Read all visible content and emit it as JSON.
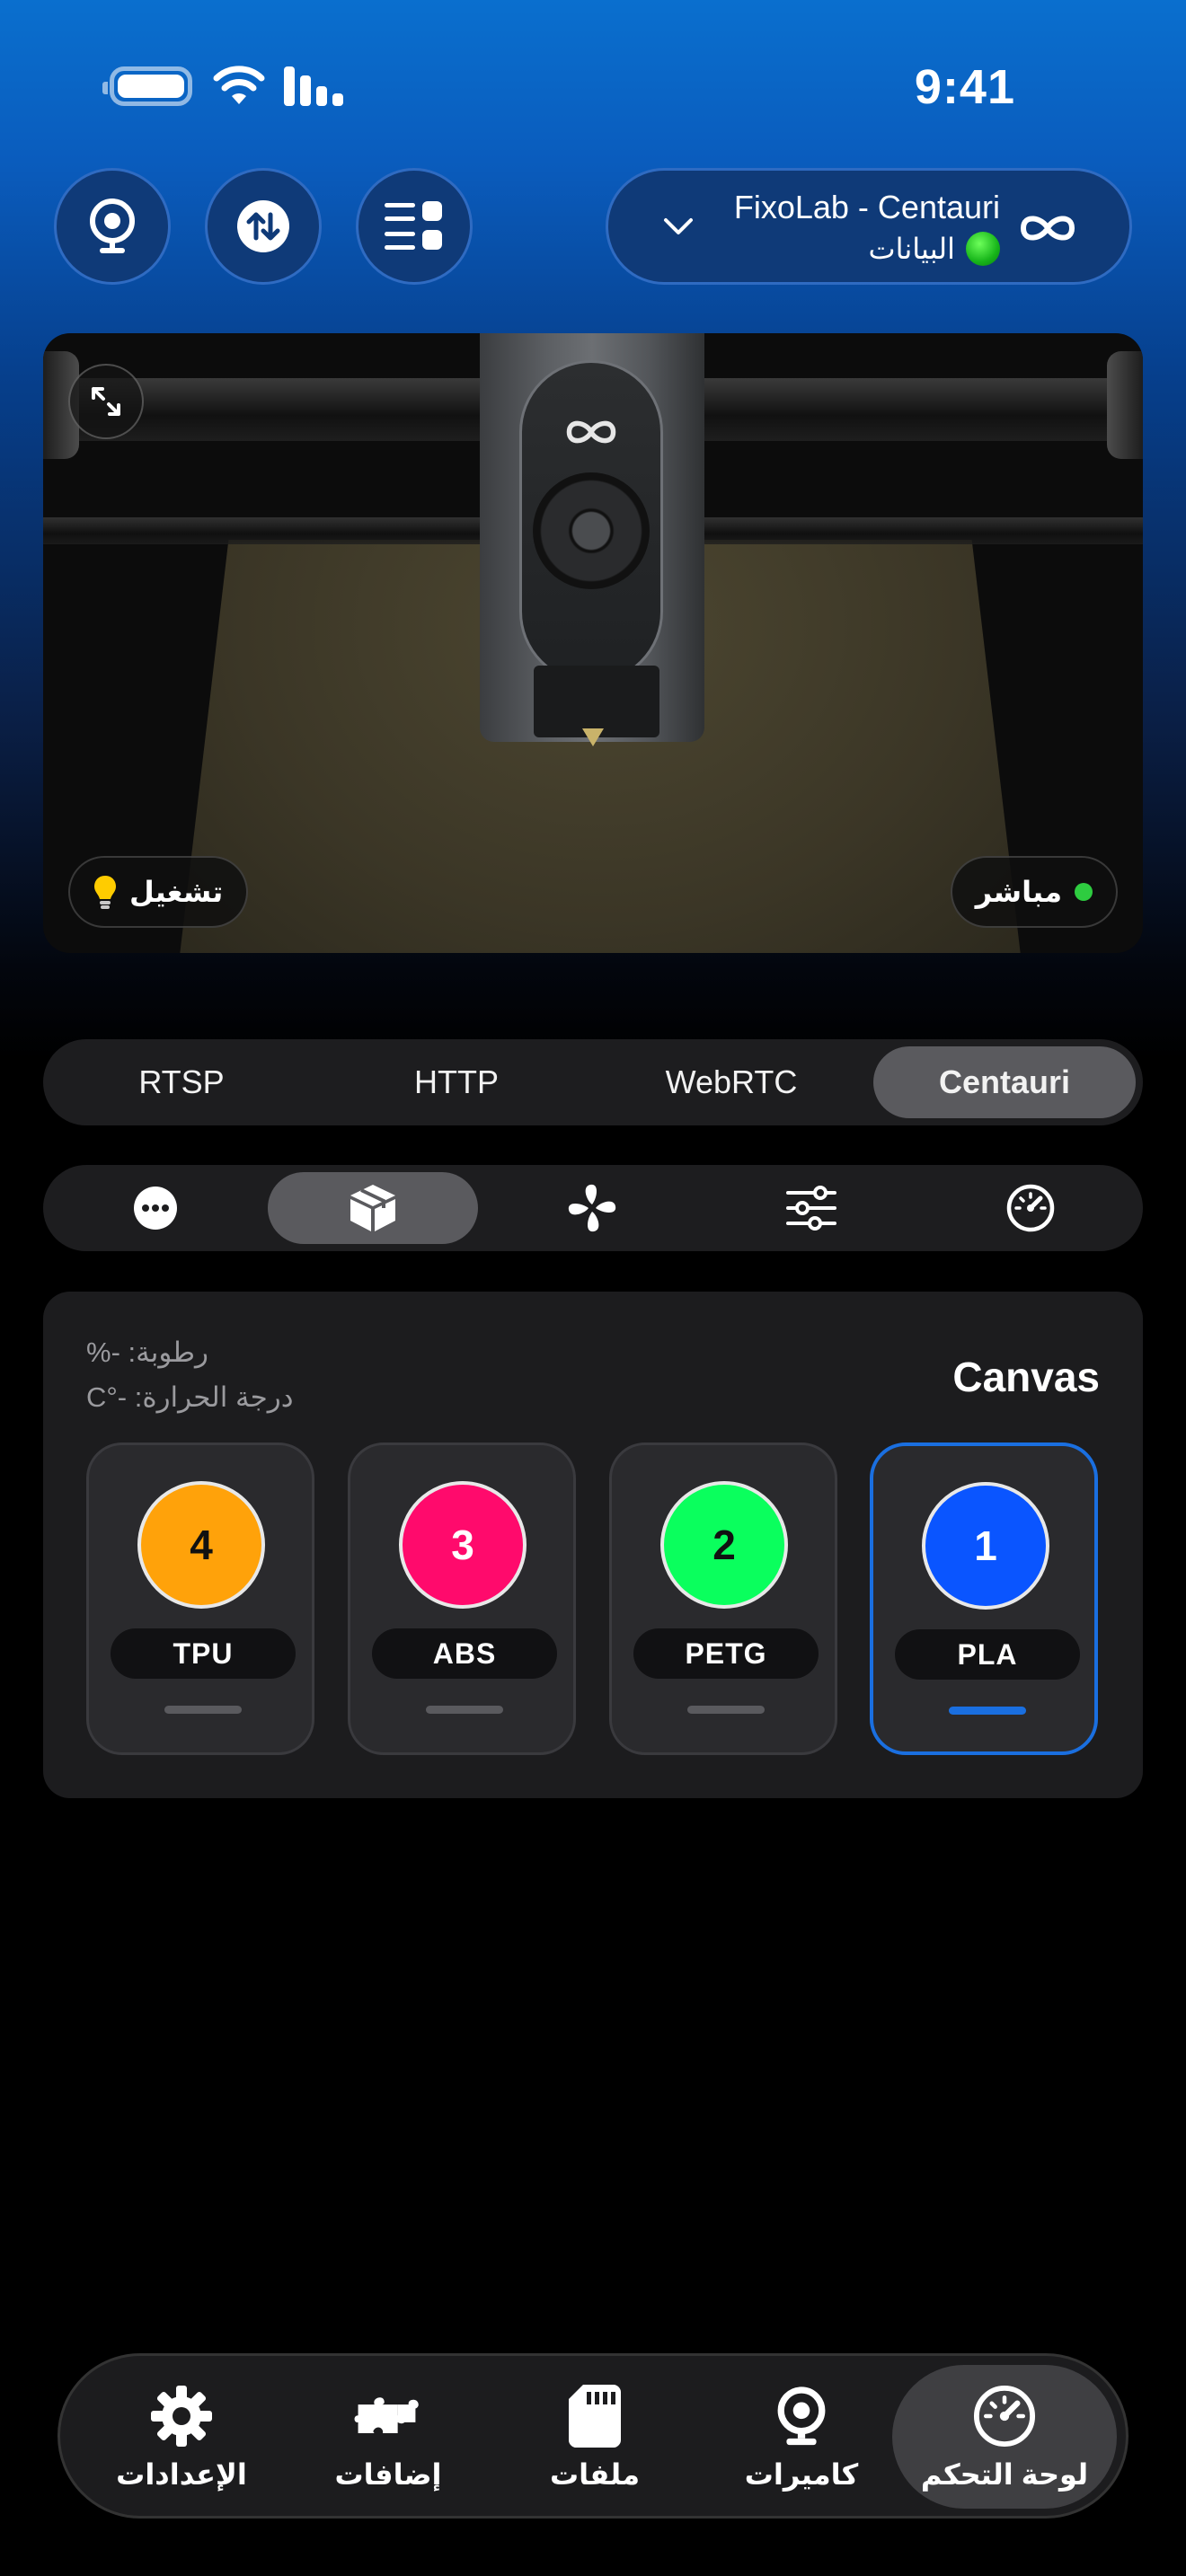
{
  "status_bar": {
    "time": "9:41"
  },
  "header": {
    "buttons": [
      "webcam-icon",
      "transfer-icon",
      "menu-grid-icon"
    ],
    "printer_name": "FixoLab - Centauri",
    "connection_label": "البيانات",
    "connection_color": "#19b51c"
  },
  "camera": {
    "light_label": "تشغيل",
    "live_label": "مباشر",
    "live_color": "#2ecc40"
  },
  "stream_tabs": {
    "items": [
      "RTSP",
      "HTTP",
      "WebRTC",
      "Centauri"
    ],
    "selected": "Centauri"
  },
  "panel_tabs": {
    "icons": [
      "more-icon",
      "box-icon",
      "fan-icon",
      "sliders-icon",
      "gauge-icon"
    ],
    "selected": "box-icon"
  },
  "canvas": {
    "title": "Canvas",
    "humidity": "رطوبة: -%",
    "temperature": "درجة الحرارة: -°C",
    "slots": [
      {
        "number": "4",
        "material": "TPU",
        "color": "#ffa20a"
      },
      {
        "number": "3",
        "material": "ABS",
        "color": "#ff0a6c"
      },
      {
        "number": "2",
        "material": "PETG",
        "color": "#0aff5d"
      },
      {
        "number": "1",
        "material": "PLA",
        "color": "#0a55ff",
        "selected": true
      }
    ]
  },
  "bottom_nav": {
    "items": [
      {
        "label": "الإعدادات",
        "icon": "gear-icon"
      },
      {
        "label": "إضافات",
        "icon": "puzzle-icon"
      },
      {
        "label": "ملفات",
        "icon": "sd-card-icon"
      },
      {
        "label": "كاميرات",
        "icon": "webcam-icon"
      },
      {
        "label": "لوحة التحكم",
        "icon": "gauge-icon",
        "selected": true
      }
    ]
  }
}
